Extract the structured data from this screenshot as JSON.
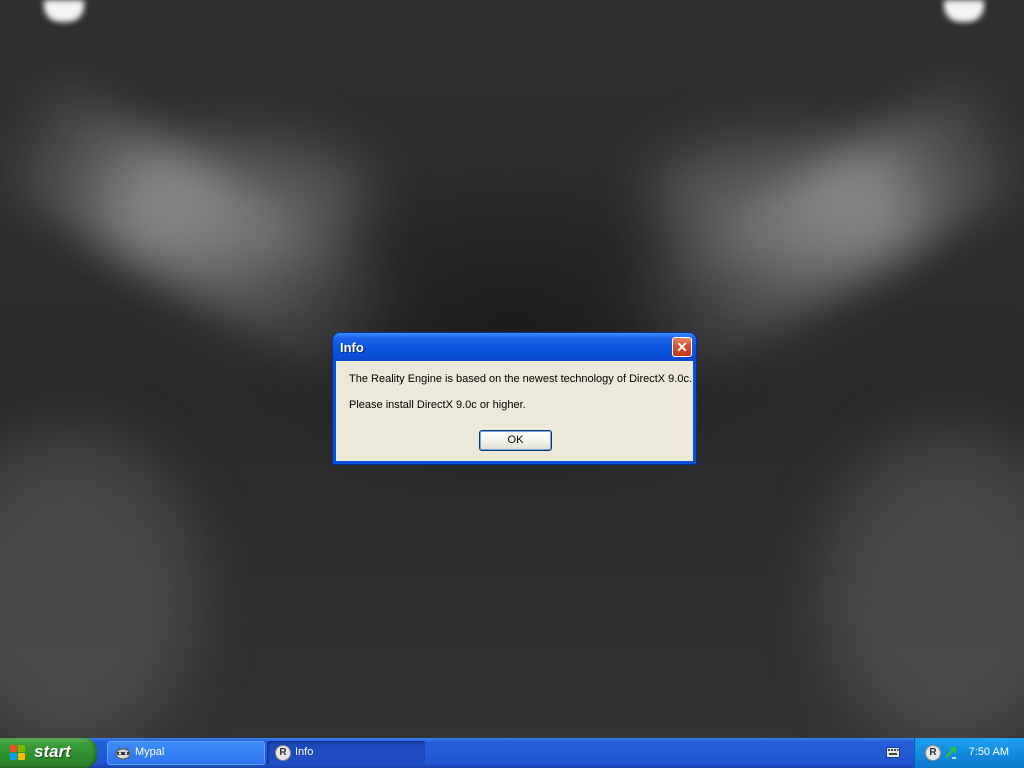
{
  "dialog": {
    "title": "Info",
    "close_glyph": "✕",
    "message_line1": "The Reality Engine is based on the newest technology of DirectX 9.0c.",
    "message_line2": "Please install DirectX 9.0c or higher.",
    "ok_label": "OK"
  },
  "taskbar": {
    "start_label": "start",
    "tasks": [
      {
        "label": "Mypal",
        "icon": "mypal-raccoon-icon",
        "active": false
      },
      {
        "label": "Info",
        "icon": "reality-engine-r-icon",
        "active": true
      }
    ],
    "tray": {
      "icons": [
        "keyboard-icon",
        "reality-engine-r-icon",
        "network-arrow-icon"
      ],
      "clock": "7:50 AM"
    },
    "task_icon_letter": "R"
  },
  "colors": {
    "titlebar_blue": "#0a4fd8",
    "dialog_body": "#ece9d8",
    "close_red": "#d3502e",
    "start_green": "#3c9d3b",
    "taskbar_blue": "#245edb",
    "tray_blue": "#128bdf"
  }
}
